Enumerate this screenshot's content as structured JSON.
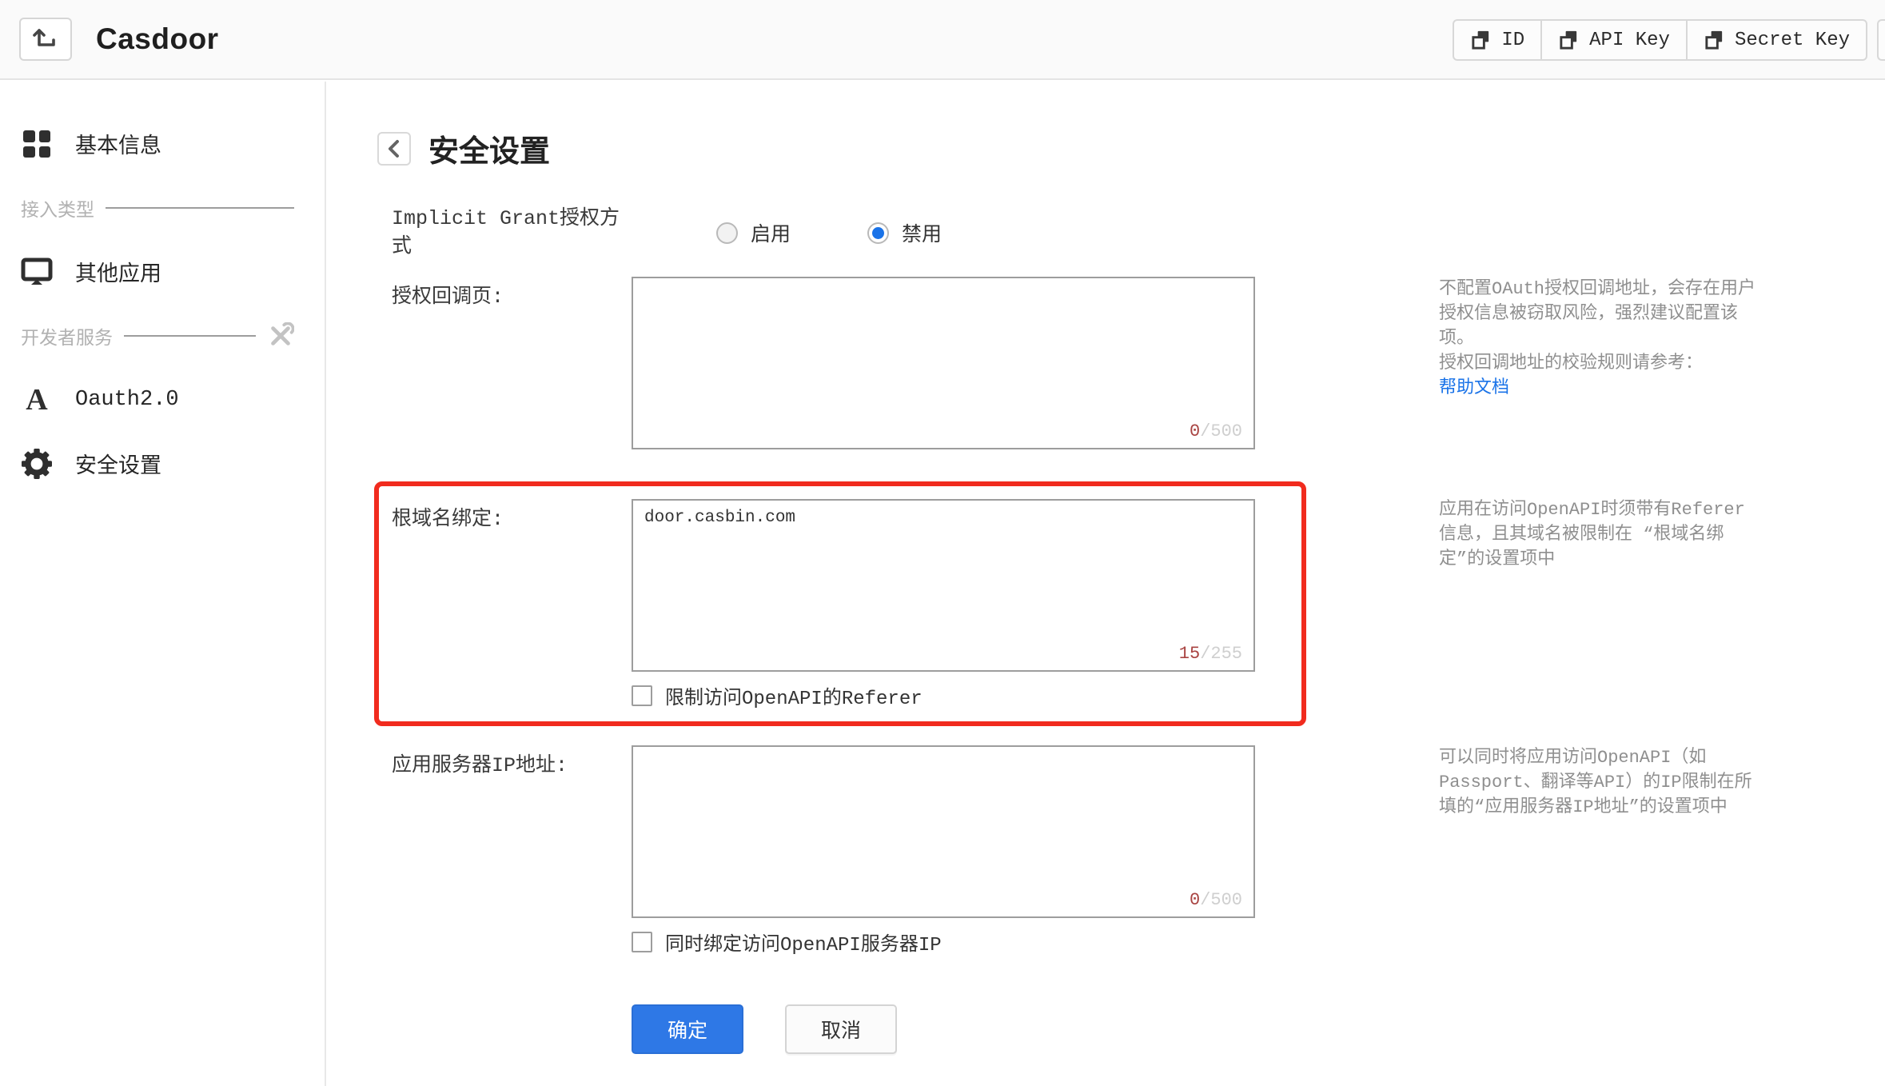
{
  "header": {
    "app_title": "Casdoor",
    "copy_buttons": [
      {
        "label": "ID"
      },
      {
        "label": "API Key"
      },
      {
        "label": "Secret Key"
      }
    ]
  },
  "sidebar": {
    "basic_info": "基本信息",
    "access_type_divider": "接入类型",
    "other_app": "其他应用",
    "developer_divider": "开发者服务",
    "oauth": "Oauth2.0",
    "security": "安全设置"
  },
  "page": {
    "title": "安全设置"
  },
  "implicit_grant": {
    "label": "Implicit Grant授权方式",
    "enable": "启用",
    "disable": "禁用"
  },
  "callback": {
    "label": "授权回调页:",
    "value": "",
    "count": "0",
    "limit": "/500",
    "help_p1": "不配置OAuth授权回调地址，会存在用户授权信息被窃取风险，强烈建议配置该项。",
    "help_p2": "授权回调地址的校验规则请参考：",
    "help_link": "帮助文档"
  },
  "root_domain": {
    "label": "根域名绑定:",
    "value": "door.casbin.com",
    "count": "15",
    "limit": "/255",
    "checkbox": "限制访问OpenAPI的Referer",
    "help": "应用在访问OpenAPI时须带有Referer信息，且其域名被限制在 “根域名绑定”的设置项中"
  },
  "server_ip": {
    "label": "应用服务器IP地址:",
    "value": "",
    "count": "0",
    "limit": "/500",
    "checkbox": "同时绑定访问OpenAPI服务器IP",
    "help": "可以同时将应用访问OpenAPI（如Passport、翻译等API）的IP限制在所填的“应用服务器IP地址”的设置项中"
  },
  "actions": {
    "ok": "确定",
    "cancel": "取消"
  },
  "icons": {
    "header_back": "up-left-arrow",
    "copy": "copy-squares",
    "basic_info": "grid",
    "other_app": "monitor",
    "developer": "tools",
    "oauth": "letter-a",
    "security": "gear",
    "page_back": "chevron-left"
  },
  "colors": {
    "primary_blue": "#2e78e6",
    "highlight_red": "#f12b1e",
    "link_blue": "#1a73e8",
    "count_red": "#a94442"
  }
}
